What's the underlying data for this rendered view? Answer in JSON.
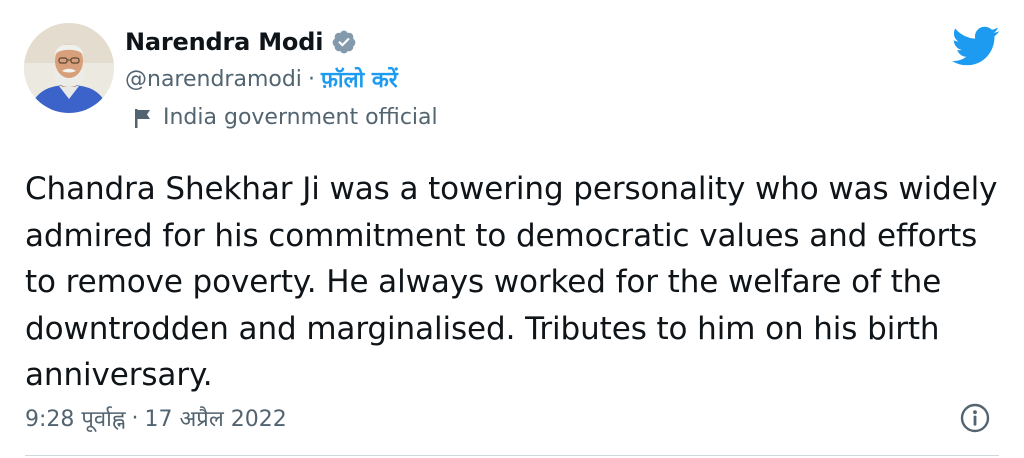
{
  "author": {
    "name": "Narendra Modi",
    "handle": "@narendramodi",
    "separator": "·",
    "follow_label": "फ़ॉलो करें",
    "account_label": "India government official"
  },
  "tweet": {
    "text": "Chandra Shekhar Ji was a towering personality who was widely admired for his commitment to democratic values and efforts to remove poverty. He always worked for the welfare of the downtrodden and marginalised. Tributes to him on his birth anniversary.",
    "time": "9:28 पूर्वाह्न",
    "separator": "·",
    "date": "17 अप्रैल 2022"
  },
  "icons": {
    "verified": "verified-badge-icon",
    "flag": "flag-icon",
    "brand": "twitter-bird-icon",
    "info": "info-icon"
  },
  "colors": {
    "brand": "#1d9bf0",
    "text": "#0f1419",
    "secondary": "#536471",
    "verified": "#829aab"
  }
}
